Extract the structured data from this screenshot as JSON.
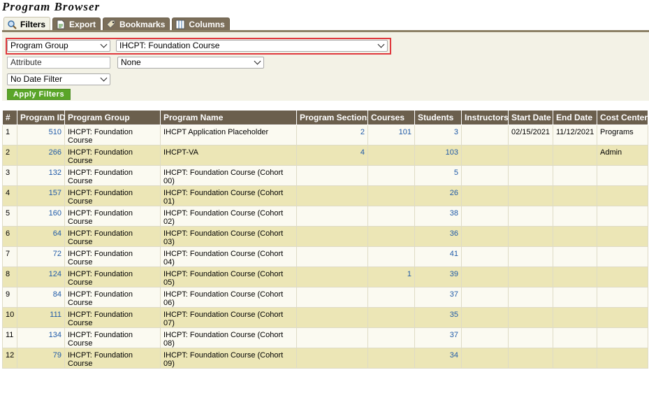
{
  "page": {
    "title": "Program Browser"
  },
  "tabs": [
    {
      "label": "Filters",
      "icon": "magnifier-icon"
    },
    {
      "label": "Export",
      "icon": "document-icon"
    },
    {
      "label": "Bookmarks",
      "icon": "bookmark-icon"
    },
    {
      "label": "Columns",
      "icon": "columns-icon"
    }
  ],
  "filters": {
    "field_select": "Program Group",
    "value_select": "IHCPT: Foundation Course",
    "attribute_placeholder": "Attribute",
    "attribute_value": "None",
    "date_filter": "No Date Filter",
    "apply_label": "Apply Filters"
  },
  "colors": {
    "header_bg": "#6b5f4d",
    "row_alt": "#ece6b6",
    "row": "#fbfaf1",
    "link": "#1f5aa8",
    "apply": "#5aa528",
    "highlight": "#e0393e"
  },
  "table": {
    "headers": [
      "#",
      "Program ID",
      "Program Group",
      "Program Name",
      "Program Sections",
      "Courses",
      "Students",
      "Instructors",
      "Start Date",
      "End Date",
      "Cost Center"
    ],
    "rows": [
      [
        "1",
        "510",
        "IHCPT: Foundation Course",
        "IHCPT Application Placeholder",
        "2",
        "101",
        "3",
        "",
        "02/15/2021",
        "11/12/2021",
        "Programs"
      ],
      [
        "2",
        "266",
        "IHCPT: Foundation Course",
        "IHCPT-VA",
        "4",
        "",
        "103",
        "",
        "",
        "",
        "Admin"
      ],
      [
        "3",
        "132",
        "IHCPT: Foundation Course",
        "IHCPT: Foundation Course (Cohort 00)",
        "",
        "",
        "5",
        "",
        "",
        "",
        ""
      ],
      [
        "4",
        "157",
        "IHCPT: Foundation Course",
        "IHCPT: Foundation Course (Cohort 01)",
        "",
        "",
        "26",
        "",
        "",
        "",
        ""
      ],
      [
        "5",
        "160",
        "IHCPT: Foundation Course",
        "IHCPT: Foundation Course (Cohort 02)",
        "",
        "",
        "38",
        "",
        "",
        "",
        ""
      ],
      [
        "6",
        "64",
        "IHCPT: Foundation Course",
        "IHCPT: Foundation Course (Cohort 03)",
        "",
        "",
        "36",
        "",
        "",
        "",
        ""
      ],
      [
        "7",
        "72",
        "IHCPT: Foundation Course",
        "IHCPT: Foundation Course (Cohort 04)",
        "",
        "",
        "41",
        "",
        "",
        "",
        ""
      ],
      [
        "8",
        "124",
        "IHCPT: Foundation Course",
        "IHCPT: Foundation Course (Cohort 05)",
        "",
        "1",
        "39",
        "",
        "",
        "",
        ""
      ],
      [
        "9",
        "84",
        "IHCPT: Foundation Course",
        "IHCPT: Foundation Course (Cohort 06)",
        "",
        "",
        "37",
        "",
        "",
        "",
        ""
      ],
      [
        "10",
        "111",
        "IHCPT: Foundation Course",
        "IHCPT: Foundation Course (Cohort 07)",
        "",
        "",
        "35",
        "",
        "",
        "",
        ""
      ],
      [
        "11",
        "134",
        "IHCPT: Foundation Course",
        "IHCPT: Foundation Course (Cohort 08)",
        "",
        "",
        "37",
        "",
        "",
        "",
        ""
      ],
      [
        "12",
        "79",
        "IHCPT: Foundation Course",
        "IHCPT: Foundation Course (Cohort 09)",
        "",
        "",
        "34",
        "",
        "",
        "",
        ""
      ]
    ]
  }
}
